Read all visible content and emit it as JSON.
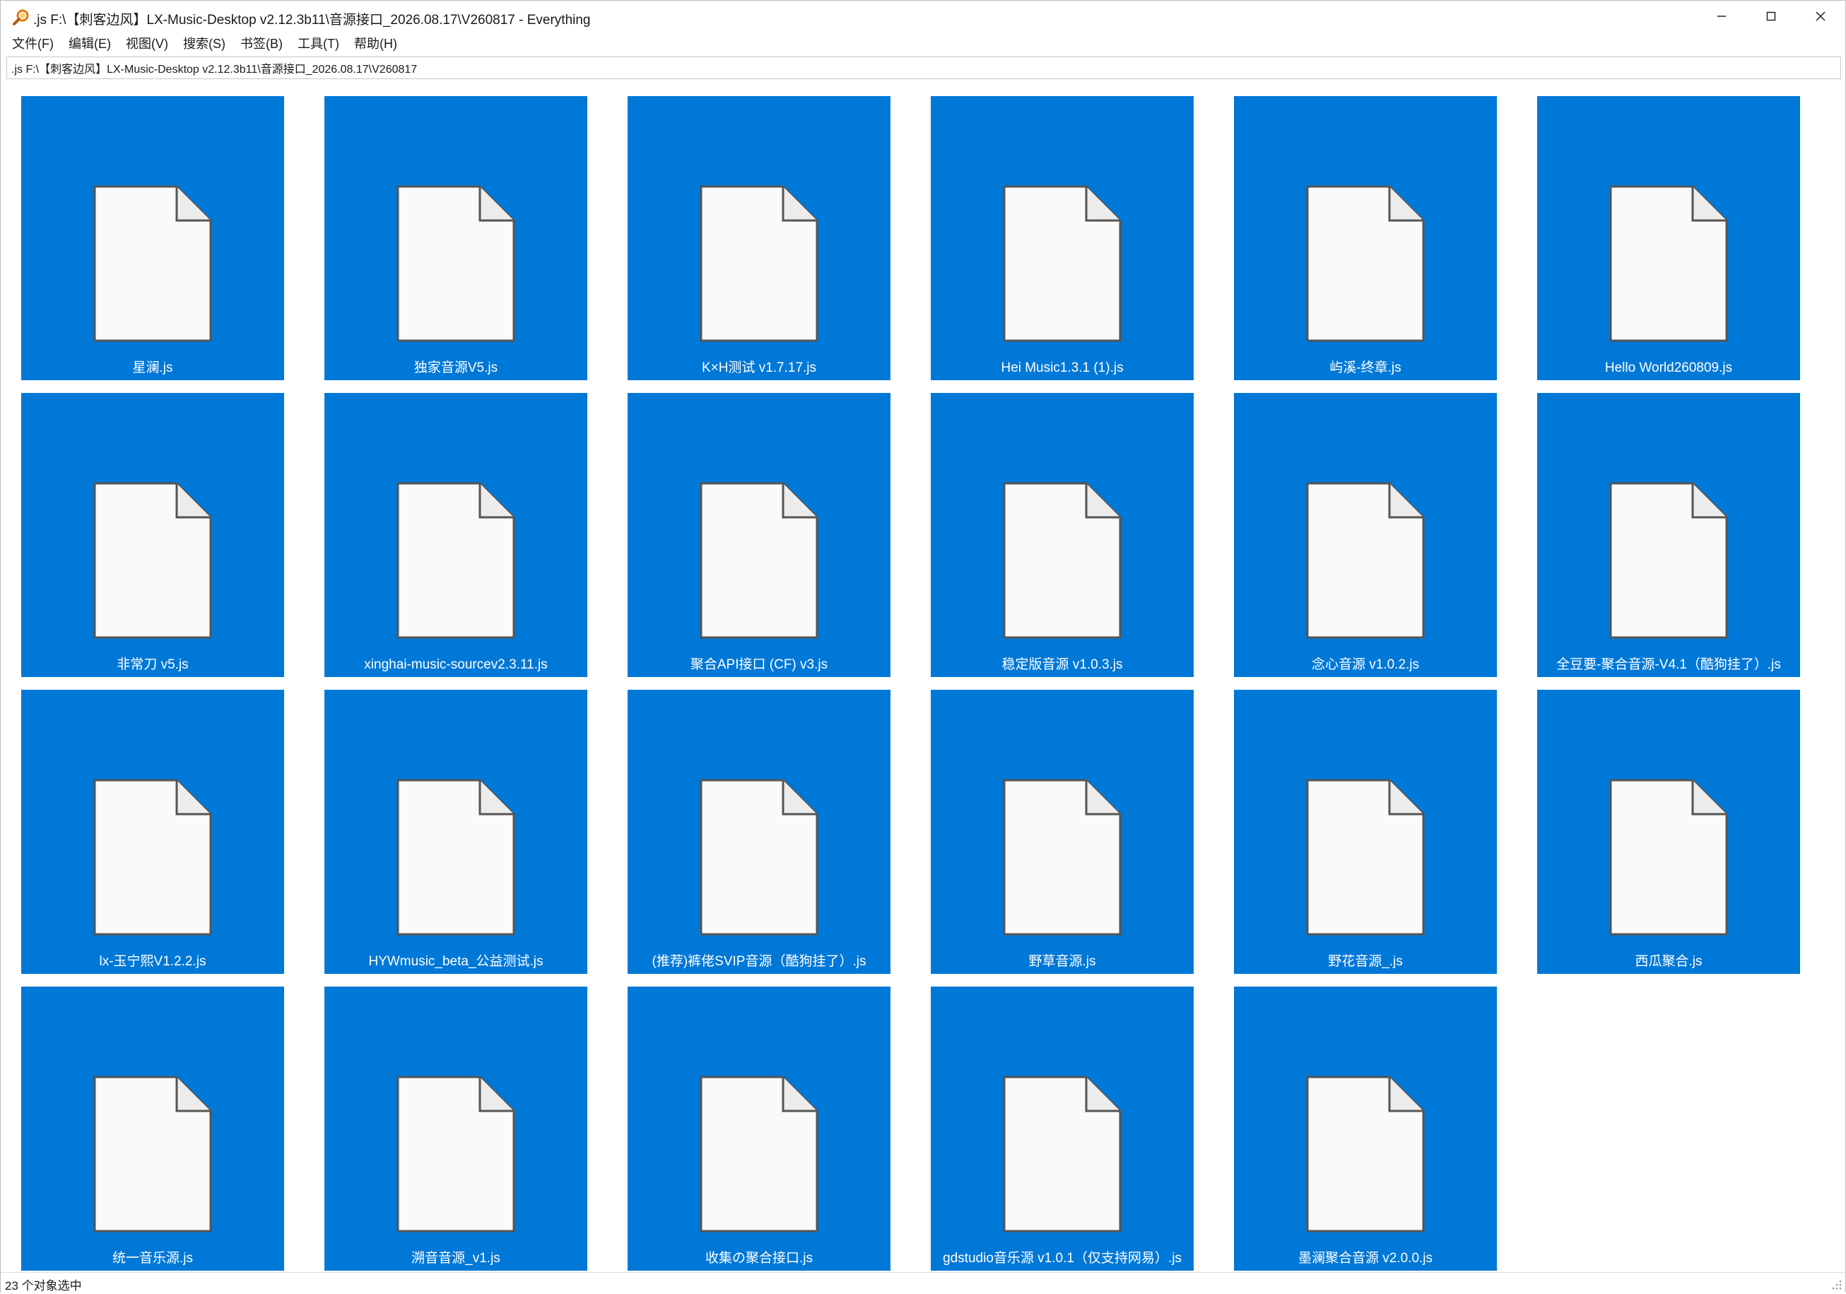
{
  "window": {
    "title": ".js F:\\【刺客边风】LX-Music-Desktop v2.12.3b11\\音源接口_2026.08.17\\V260817 - Everything",
    "app_icon": "everything-search-icon"
  },
  "menu": [
    "文件(F)",
    "编辑(E)",
    "视图(V)",
    "搜索(S)",
    "书签(B)",
    "工具(T)",
    "帮助(H)"
  ],
  "search": {
    "value": ".js F:\\【刺客边风】LX-Music-Desktop v2.12.3b11\\音源接口_2026.08.17\\V260817"
  },
  "files": [
    "星澜.js",
    "独家音源V5.js",
    "K×H测试 v1.7.17.js",
    "Hei Music1.3.1 (1).js",
    "屿溪-终章.js",
    "Hello World260809.js",
    "非常刀 v5.js",
    "xinghai-music-sourcev2.3.11.js",
    "聚合API接口 (CF) v3.js",
    "稳定版音源 v1.0.3.js",
    "念心音源 v1.0.2.js",
    "全豆要-聚合音源-V4.1（酷狗挂了）.js",
    "lx-玉宁熙V1.2.2.js",
    "HYWmusic_beta_公益测试.js",
    "(推荐)裤佬SVIP音源（酷狗挂了）.js",
    "野草音源.js",
    "野花音源_.js",
    "西瓜聚合.js",
    "统一音乐源.js",
    "溯音音源_v1.js",
    "收集の聚合接口.js",
    "gdstudio音乐源 v1.0.1（仅支持网易）.js",
    "墨澜聚合音源 v2.0.0.js"
  ],
  "status": {
    "text": "23 个对象选中"
  },
  "colors": {
    "selection": "#0078d7",
    "file_icon_fill": "#fafafa",
    "file_icon_stroke": "#555555"
  },
  "icons": {
    "minimize": "minimize-icon",
    "maximize": "maximize-icon",
    "close": "close-icon",
    "file": "file-icon"
  }
}
